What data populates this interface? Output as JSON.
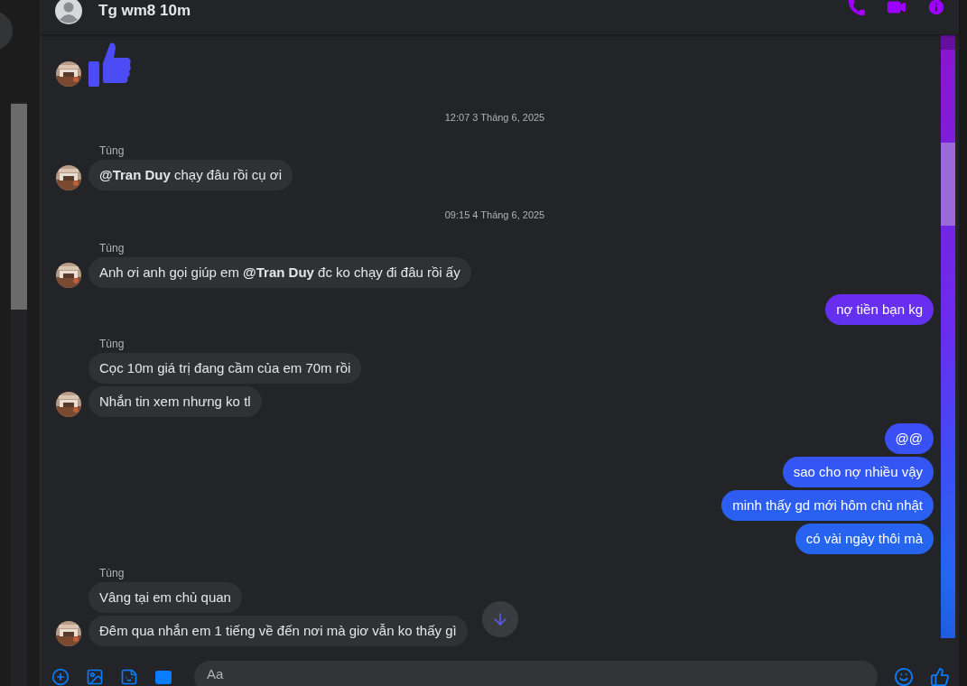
{
  "header": {
    "title": "Tg wm8 10m"
  },
  "messages": [
    {
      "kind": "like",
      "avatar": true
    },
    {
      "kind": "timestamp",
      "text": "12:07 3 Tháng 6, 2025"
    },
    {
      "kind": "sender",
      "text": "Tùng"
    },
    {
      "kind": "incoming",
      "text": "**@Tran Duy** chạy đâu rồi cụ ơi",
      "avatar": true
    },
    {
      "kind": "timestamp",
      "text": "09:15 4 Tháng 6, 2025"
    },
    {
      "kind": "sender",
      "text": "Tùng"
    },
    {
      "kind": "incoming",
      "text": "Anh ơi anh gọi giúp em **@Tran Duy**  đc ko chạy đi đâu rồi ấy",
      "avatar": true
    },
    {
      "kind": "outgoing",
      "text": "nợ tiền bạn kg"
    },
    {
      "kind": "sender",
      "text": "Tùng"
    },
    {
      "kind": "incoming",
      "text": "Cọc 10m giá trị đang cầm của em 70m rồi",
      "avatar": false
    },
    {
      "kind": "incoming",
      "text": "Nhắn tin xem nhưng ko tl",
      "avatar": true
    },
    {
      "kind": "outgoing",
      "text": "@@"
    },
    {
      "kind": "outgoing",
      "text": "sao cho nợ nhiều vậy"
    },
    {
      "kind": "outgoing",
      "text": "minh thấy gd mới hôm chủ nhật"
    },
    {
      "kind": "outgoing",
      "text": "có vài ngày thôi mà"
    },
    {
      "kind": "sender",
      "text": "Tùng"
    },
    {
      "kind": "incoming",
      "text": "Vâng tại em chủ quan",
      "avatar": false
    },
    {
      "kind": "incoming",
      "text": "Đêm qua nhắn em 1 tiếng về đến nơi mà giơ vẫn ko thấy gì",
      "avatar": true
    }
  ],
  "composer": {
    "placeholder": "Aa"
  }
}
